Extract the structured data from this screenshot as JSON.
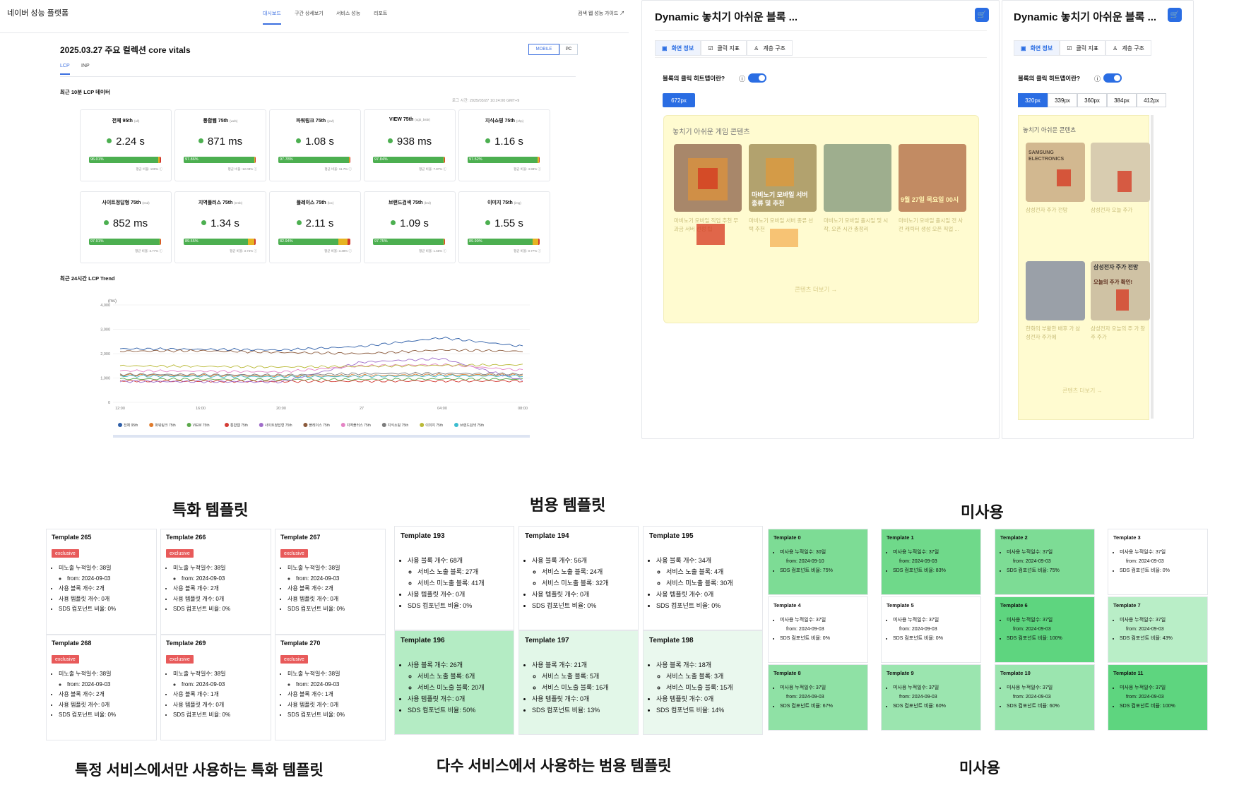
{
  "dashboard": {
    "brand": "네이버 성능 플랫폼",
    "nav_tabs": [
      "대시보드",
      "구간 상세보기",
      "서비스 성능",
      "리포트"
    ],
    "guide_link": "검색 웹 성능 가이드 ↗",
    "title": "2025.03.27 주요 컬렉션 core vitals",
    "device_toggle": [
      "MOBILE",
      "PC"
    ],
    "sub_tabs": [
      "LCP",
      "INP"
    ],
    "recent_label": "최근 10분 LCP 데이터",
    "time_label": "로그 시간: 2025/03/27 10:24:00 GMT+9",
    "cards": [
      {
        "label": "전체 95th",
        "sub": "(all)",
        "value": "2.24 s",
        "percent": "96.01%",
        "good": 96.01,
        "mid": 2.5,
        "footer": "평균 비율: 100%"
      },
      {
        "label": "통합웹 75th",
        "sub": "(web)",
        "value": "871 ms",
        "percent": "97.86%",
        "good": 97.86,
        "mid": 1.6,
        "footer": "평균 비율: 12.03%"
      },
      {
        "label": "파워링크 75th",
        "sub": "(pwl)",
        "value": "1.08 s",
        "percent": "97.78%",
        "good": 97.78,
        "mid": 1.7,
        "footer": "평균 비율: 11.7%"
      },
      {
        "label": "VIEW 75th",
        "sub": "(ugb_bsttr)",
        "value": "938 ms",
        "percent": "97.84%",
        "good": 97.84,
        "mid": 1.7,
        "footer": "평균 비율: 7.87%"
      },
      {
        "label": "지식쇼핑 75th",
        "sub": "(shp)",
        "value": "1.16 s",
        "percent": "97.52%",
        "good": 97.52,
        "mid": 2.0,
        "footer": "평균 비율: 4.98%"
      },
      {
        "label": "사이트정답형 75th",
        "sub": "(nsd)",
        "value": "852 ms",
        "percent": "97.91%",
        "good": 97.91,
        "mid": 1.6,
        "footer": "평균 비율: 3.77%"
      },
      {
        "label": "지역플러스 75th",
        "sub": "(nmb)",
        "value": "1.34 s",
        "percent": "89.55%",
        "good": 89.55,
        "mid": 8.5,
        "footer": "평균 비율: 3.74%"
      },
      {
        "label": "플레이스 75th",
        "sub": "(loc)",
        "value": "2.11 s",
        "percent": "82.94%",
        "good": 82.94,
        "mid": 13.5,
        "footer": "평균 비율: 3.49%"
      },
      {
        "label": "브랜드검색 75th",
        "sub": "(brd)",
        "value": "1.09 s",
        "percent": "97.75%",
        "good": 97.75,
        "mid": 1.7,
        "footer": "평균 비율: 1.66%"
      },
      {
        "label": "이미지 75th",
        "sub": "(img)",
        "value": "1.55 s",
        "percent": "89.99%",
        "good": 89.99,
        "mid": 8.0,
        "footer": "평균 비율: 0.77%"
      }
    ],
    "trend": {
      "title": "최근 24시간 LCP Trend",
      "unit": "(ms)",
      "y_ticks": [
        "4,000",
        "3,000",
        "2,000",
        "1,000",
        "0"
      ],
      "x_ticks": [
        "12:00",
        "16:00",
        "20:00",
        "27",
        "04:00",
        "08:00"
      ]
    }
  },
  "chart_data": {
    "type": "line",
    "title": "최근 24시간 LCP Trend",
    "ylabel": "(ms)",
    "ylim": [
      0,
      4000
    ],
    "x": [
      "12:00",
      "16:00",
      "20:00",
      "27",
      "04:00",
      "08:00"
    ],
    "series": [
      {
        "name": "전체 95th",
        "color": "#2f5fa8",
        "values": [
          2200,
          2180,
          2150,
          2300,
          2650,
          2300
        ]
      },
      {
        "name": "파워링크 75th",
        "color": "#e07b2c",
        "values": [
          1120,
          1100,
          1080,
          1100,
          1130,
          1120
        ]
      },
      {
        "name": "VIEW 75th",
        "color": "#5aa84a",
        "values": [
          960,
          950,
          930,
          940,
          960,
          950
        ]
      },
      {
        "name": "통합웹 75th",
        "color": "#d43c35",
        "values": [
          880,
          870,
          860,
          870,
          880,
          875
        ]
      },
      {
        "name": "사이트정답형 75th",
        "color": "#9f6cc9",
        "values": [
          860,
          850,
          840,
          1650,
          1800,
          900
        ]
      },
      {
        "name": "플레이스 75th",
        "color": "#8b5a3c",
        "values": [
          2100,
          2120,
          2050,
          2000,
          2150,
          2100
        ]
      },
      {
        "name": "지역플러스 75th",
        "color": "#e483c4",
        "values": [
          1300,
          1280,
          1250,
          1500,
          1550,
          1320
        ]
      },
      {
        "name": "지식쇼핑 75th",
        "color": "#7c7c7c",
        "values": [
          1150,
          1140,
          1120,
          1180,
          1190,
          1160
        ]
      },
      {
        "name": "이미지 75th",
        "color": "#b9b937",
        "values": [
          1500,
          1480,
          1450,
          1480,
          1520,
          1540
        ]
      },
      {
        "name": "브랜드검색 75th",
        "color": "#3bbccf",
        "values": [
          1080,
          1070,
          1050,
          1070,
          1090,
          1085
        ]
      }
    ]
  },
  "heatmap_wide": {
    "title": "Dynamic 놓치기 아쉬운 블록 ...",
    "tabs": [
      "화면 정보",
      "클릭 지표",
      "계층 구조"
    ],
    "question": "블록의 클릭 히트맵이란?",
    "widths": [
      "672px"
    ],
    "block_title": "놓치기 아쉬운 게임 콘텐츠",
    "thumb_captions": [
      "마비노기 모바일 서버 종류 및 추천",
      "9월 27일 목요일 00시"
    ],
    "items": [
      "마비노기 모바일 직업 추천 무과금 서버 선정 팁",
      "마비노기 모바일 서버 종류 선택 추천",
      "마비노기 모바일 출시일 및 시작, 오픈 시간 총정리",
      "마비노기 모바일 출시일 전 사전 캐릭터 생성 오픈 직업 ..."
    ],
    "more": "콘텐츠 더보기 →"
  },
  "heatmap_narrow": {
    "title": "Dynamic 놓치기 아쉬운 블록 ...",
    "tabs": [
      "화면 정보",
      "클릭 지표",
      "계층 구조"
    ],
    "question": "블록의 클릭 히트맵이란?",
    "widths": [
      "320px",
      "339px",
      "360px",
      "384px",
      "412px"
    ],
    "block_title": "놓치기 아쉬운 콘텐츠",
    "items": [
      "삼성전자 주가 전망",
      "삼성전자 오늘 주가",
      "한화의 부활한 배후 가 삼성전자 주가에",
      "삼성전자 오늘의 주 가 창주 주가"
    ],
    "thumb_captions": [
      "SAMSUNG ELECTRONICS",
      "삼성전자 주가 전망",
      "오늘의 주가 확인!"
    ],
    "more": "콘텐츠 더보기 →"
  },
  "sections": {
    "specialized_heading": "특화 템플릿",
    "generic_heading": "범용 템플릿",
    "unused_heading": "미사용",
    "specialized_caption": "특정 서비스에서만 사용하는 특화 템플릿",
    "generic_caption": "다수 서비스에서 사용하는 범용 템플릿",
    "unused_caption": "미사용"
  },
  "specialized_templates": [
    {
      "name": "Template 265",
      "badge": "exclusive",
      "l1": "미노출 누적일수: 38일",
      "l2": "from: 2024-09-03",
      "l3": "사용 블록 개수: 2개",
      "l4": "사용 템플릿 개수: 0개",
      "l5": "SDS 컴포넌트 비율: 0%"
    },
    {
      "name": "Template 266",
      "badge": "exclusive",
      "l1": "미노출 누적일수: 38일",
      "l2": "from: 2024-09-03",
      "l3": "사용 블록 개수: 2개",
      "l4": "사용 템플릿 개수: 0개",
      "l5": "SDS 컴포넌트 비율: 0%"
    },
    {
      "name": "Template 267",
      "badge": "exclusive",
      "l1": "미노출 누적일수: 38일",
      "l2": "from: 2024-09-03",
      "l3": "사용 블록 개수: 2개",
      "l4": "사용 템플릿 개수: 0개",
      "l5": "SDS 컴포넌트 비율: 0%"
    },
    {
      "name": "Template 268",
      "badge": "exclusive",
      "l1": "미노출 누적일수: 38일",
      "l2": "from: 2024-09-03",
      "l3": "사용 블록 개수: 2개",
      "l4": "사용 템플릿 개수: 0개",
      "l5": "SDS 컴포넌트 비율: 0%"
    },
    {
      "name": "Template 269",
      "badge": "exclusive",
      "l1": "미노출 누적일수: 38일",
      "l2": "from: 2024-09-03",
      "l3": "사용 블록 개수: 1개",
      "l4": "사용 템플릿 개수: 0개",
      "l5": "SDS 컴포넌트 비율: 0%"
    },
    {
      "name": "Template 270",
      "badge": "exclusive",
      "l1": "미노출 누적일수: 38일",
      "l2": "from: 2024-09-03",
      "l3": "사용 블록 개수: 1개",
      "l4": "사용 템플릿 개수: 0개",
      "l5": "SDS 컴포넌트 비율: 0%"
    }
  ],
  "generic_templates": [
    {
      "name": "Template 193",
      "bg": "#ffffff",
      "l1": "사용 블록 개수: 68개",
      "l2": "서비스 노출 블록: 27개",
      "l3": "서비스 미노출 블록: 41개",
      "l4": "사용 템플릿 개수: 0개",
      "l5": "SDS 컴포넌트 비율: 0%"
    },
    {
      "name": "Template 194",
      "bg": "#ffffff",
      "l1": "사용 블록 개수: 56개",
      "l2": "서비스 노출 블록: 24개",
      "l3": "서비스 미노출 블록: 32개",
      "l4": "사용 템플릿 개수: 0개",
      "l5": "SDS 컴포넌트 비율: 0%"
    },
    {
      "name": "Template 195",
      "bg": "#ffffff",
      "l1": "사용 블록 개수: 34개",
      "l2": "서비스 노출 블록: 4개",
      "l3": "서비스 미노출 블록: 30개",
      "l4": "사용 템플릿 개수: 0개",
      "l5": "SDS 컴포넌트 비율: 0%"
    },
    {
      "name": "Template 196",
      "bg": "#b4ecc4",
      "l1": "사용 블록 개수: 26개",
      "l2": "서비스 노출 블록: 6개",
      "l3": "서비스 미노출 블록: 20개",
      "l4": "사용 템플릿 개수: 0개",
      "l5": "SDS 컴포넌트 비율: 50%"
    },
    {
      "name": "Template 197",
      "bg": "#e2f7e8",
      "l1": "사용 블록 개수: 21개",
      "l2": "서비스 노출 블록: 5개",
      "l3": "서비스 미노출 블록: 16개",
      "l4": "사용 템플릿 개수: 0개",
      "l5": "SDS 컴포넌트 비율: 13%"
    },
    {
      "name": "Template 198",
      "bg": "#eaf8ee",
      "l1": "사용 블록 개수: 18개",
      "l2": "서비스 노출 블록: 3개",
      "l3": "서비스 미노출 블록: 15개",
      "l4": "사용 템플릿 개수: 0개",
      "l5": "SDS 컴포넌트 비율: 14%"
    }
  ],
  "unused_templates": [
    {
      "name": "Template 0",
      "bg": "#7ddc95",
      "l1": "미사용 누적일수: 30일",
      "l2": "from: 2024-09-10",
      "l3": "SDS 컴포넌트 비율: 75%"
    },
    {
      "name": "Template 1",
      "bg": "#6fd98a",
      "l1": "미사용 누적일수: 37일",
      "l2": "from: 2024-09-03",
      "l3": "SDS 컴포넌트 비율: 83%"
    },
    {
      "name": "Template 2",
      "bg": "#7ddc95",
      "l1": "미사용 누적일수: 37일",
      "l2": "from: 2024-09-03",
      "l3": "SDS 컴포넌트 비율: 75%"
    },
    {
      "name": "Template 3",
      "bg": "#ffffff",
      "l1": "미사용 누적일수: 37일",
      "l2": "from: 2024-09-03",
      "l3": "SDS 컴포넌트 비율: 0%"
    },
    {
      "name": "Template 4",
      "bg": "#ffffff",
      "l1": "미사용 누적일수: 37일",
      "l2": "from: 2024-09-03",
      "l3": "SDS 컴포넌트 비율: 0%"
    },
    {
      "name": "Template 5",
      "bg": "#ffffff",
      "l1": "미사용 누적일수: 37일",
      "l2": "from: 2024-09-03",
      "l3": "SDS 컴포넌트 비율: 0%"
    },
    {
      "name": "Template 6",
      "bg": "#5ed57f",
      "l1": "미사용 누적일수: 37일",
      "l2": "from: 2024-09-03",
      "l3": "SDS 컴포넌트 비율: 100%"
    },
    {
      "name": "Template 7",
      "bg": "#b9eec7",
      "l1": "미사용 누적일수: 37일",
      "l2": "from: 2024-09-03",
      "l3": "SDS 컴포넌트 비율: 43%"
    },
    {
      "name": "Template 8",
      "bg": "#8fe1a5",
      "l1": "미사용 누적일수: 37일",
      "l2": "from: 2024-09-03",
      "l3": "SDS 컴포넌트 비율: 67%"
    },
    {
      "name": "Template 9",
      "bg": "#9be5af",
      "l1": "미사용 누적일수: 37일",
      "l2": "from: 2024-09-03",
      "l3": "SDS 컴포넌트 비율: 60%"
    },
    {
      "name": "Template 10",
      "bg": "#9be5af",
      "l1": "미사용 누적일수: 37일",
      "l2": "from: 2024-09-03",
      "l3": "SDS 컴포넌트 비율: 60%"
    },
    {
      "name": "Template 11",
      "bg": "#5ed57f",
      "l1": "미사용 누적일수: 37일",
      "l2": "from: 2024-09-03",
      "l3": "SDS 컴포넌트 비율: 100%"
    }
  ]
}
